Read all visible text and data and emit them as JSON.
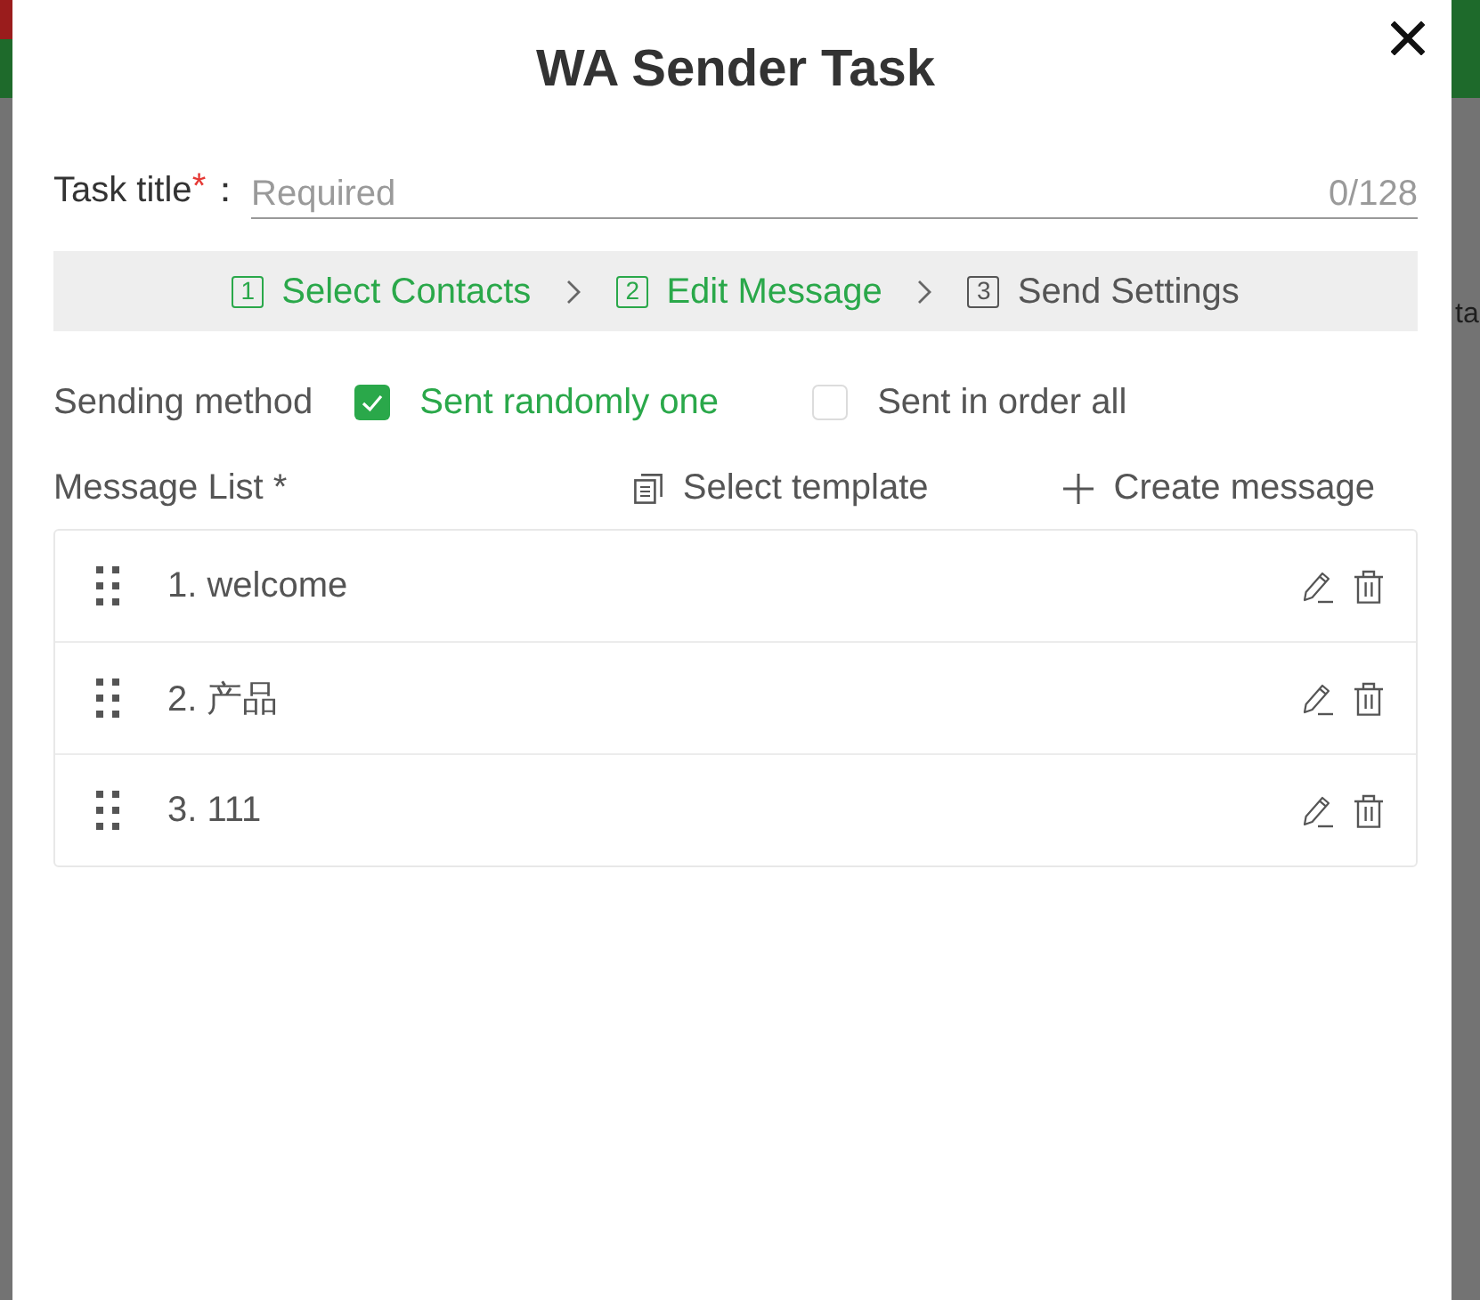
{
  "background_page": {
    "text": "ta"
  },
  "dialog": {
    "title": "WA Sender Task"
  },
  "task_title": {
    "label": "Task title",
    "required_mark": "*",
    "separator": "：",
    "placeholder": "Required",
    "counter": "0/128"
  },
  "steps": [
    {
      "number": "1",
      "label": "Select Contacts",
      "active": true
    },
    {
      "number": "2",
      "label": "Edit Message",
      "active": true
    },
    {
      "number": "3",
      "label": "Send Settings",
      "active": false
    }
  ],
  "sending_method": {
    "label": "Sending method",
    "options": [
      {
        "label": "Sent randomly one",
        "selected": true
      },
      {
        "label": "Sent in order all",
        "selected": false
      }
    ]
  },
  "message_list": {
    "label": "Message List *",
    "actions": [
      {
        "kind": "template",
        "label": "Select template"
      },
      {
        "kind": "create",
        "label": "Create message"
      }
    ],
    "items": [
      {
        "text": "1. welcome"
      },
      {
        "text": "2. 产品"
      },
      {
        "text": "3. 111"
      }
    ]
  }
}
